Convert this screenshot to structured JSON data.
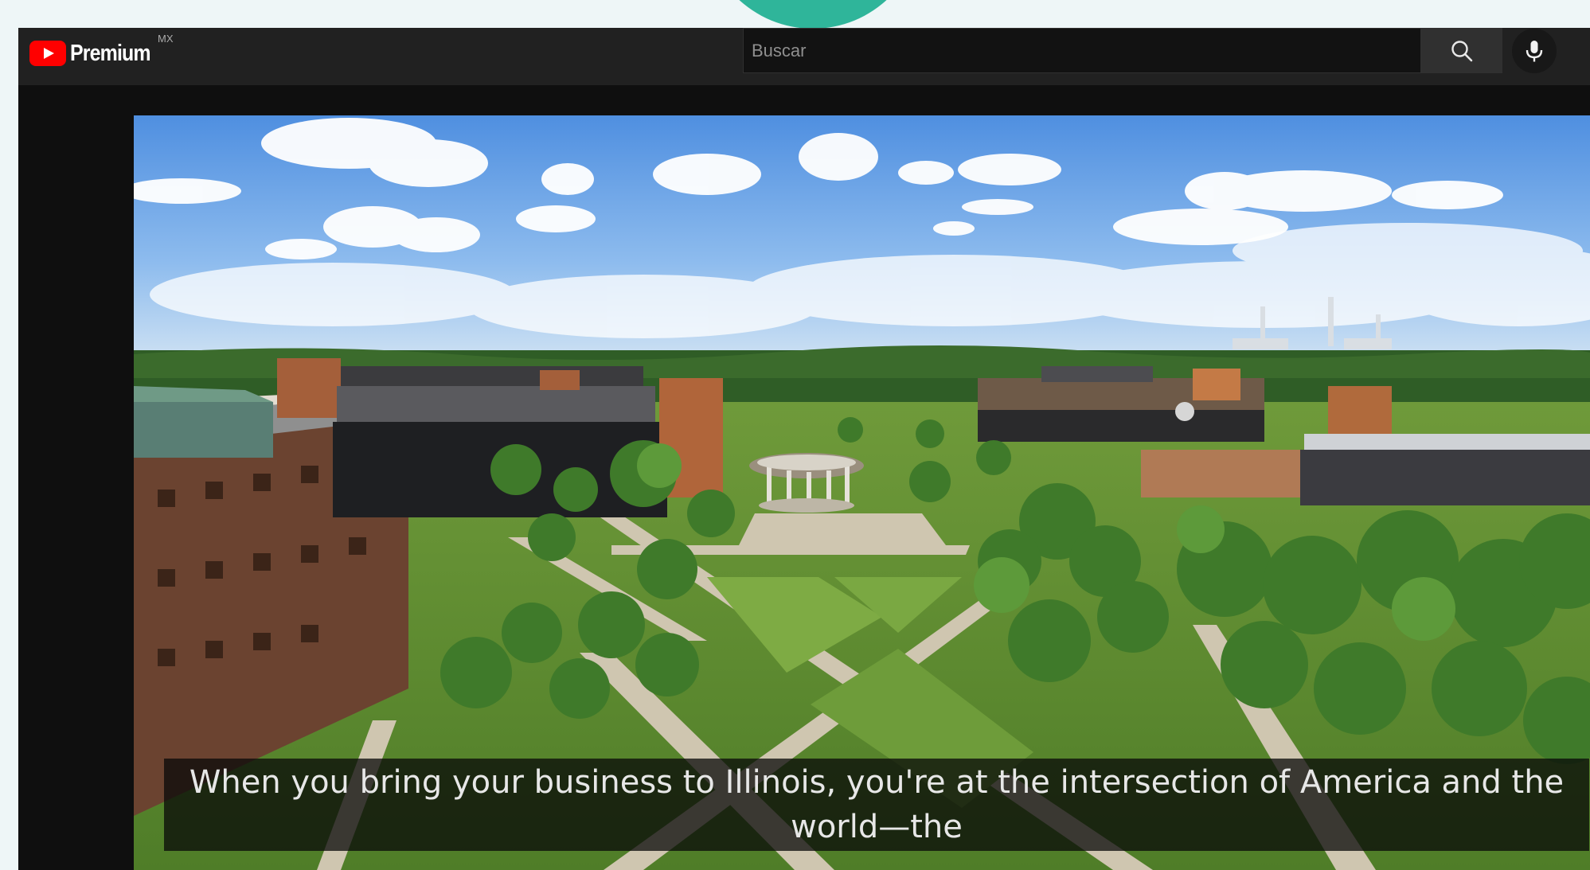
{
  "app": {
    "brand_label": "Premium",
    "region_code": "MX",
    "logo_icon": "youtube-play-icon"
  },
  "search": {
    "placeholder": "Buscar",
    "value": "",
    "search_icon": "search-icon",
    "voice_icon": "microphone-icon"
  },
  "player": {
    "caption": "When you bring your business to Illinois, you're at the intersection of America and the world—the",
    "video_frame": "aerial view of a university campus quad with brick buildings, trees, crossing paths and a round pavilion"
  },
  "colors": {
    "masthead": "#212121",
    "background": "#0f0f0f",
    "brand_red": "#ff0000",
    "accent_teal": "#2fb59a"
  }
}
